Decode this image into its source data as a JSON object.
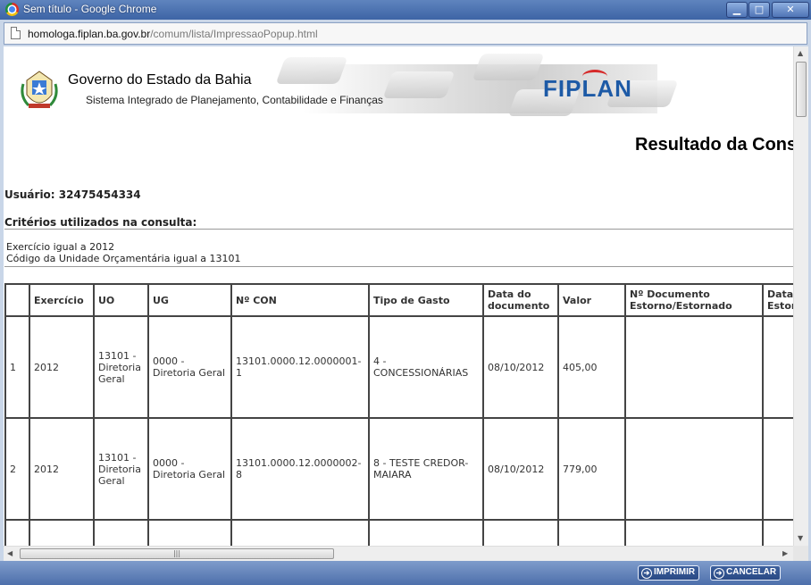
{
  "window": {
    "title": "Sem título - Google Chrome",
    "minimize": "▁",
    "maximize": "□",
    "close": "✕"
  },
  "address": {
    "host": "homologa.fiplan.ba.gov.br",
    "path": "/comum/lista/ImpressaoPopup.html"
  },
  "header": {
    "gov_title": "Governo do Estado da Bahia",
    "gov_subtitle": "Sistema Integrado de Planejamento, Contabilidade e Finanças",
    "logo": "FIPLAN",
    "crest_icon": "bahia-crest-icon"
  },
  "page": {
    "result_title": "Resultado da Consulta",
    "usuario": "Usuário: 32475454334",
    "criterios_label": "Critérios utilizados na consulta:",
    "criterios": [
      "Exercício igual a 2012",
      "Código da Unidade Orçamentária igual a 13101"
    ]
  },
  "table": {
    "columns": [
      "",
      "Exercício",
      "UO",
      "UG",
      "Nº CON",
      "Tipo de Gasto",
      "Data do documento",
      "Valor",
      "Nº Documento Estorno/Estornado",
      "Data Estorno"
    ],
    "rows": [
      [
        "1",
        "2012",
        "13101 - Diretoria Geral",
        "0000 - Diretoria Geral",
        "13101.0000.12.0000001-1",
        "4 - CONCESSIONÁRIAS",
        "08/10/2012",
        "405,00",
        "",
        ""
      ],
      [
        "2",
        "2012",
        "13101 - Diretoria Geral",
        "0000 - Diretoria Geral",
        "13101.0000.12.0000002-8",
        "8 - TESTE CREDOR-MAIARA",
        "08/10/2012",
        "779,00",
        "",
        ""
      ]
    ]
  },
  "footer": {
    "print_label": "IMPRIMIR",
    "cancel_label": "CANCELAR"
  },
  "colors": {
    "window_accent": "#4a6fae",
    "brand": "#1d5aa6"
  }
}
